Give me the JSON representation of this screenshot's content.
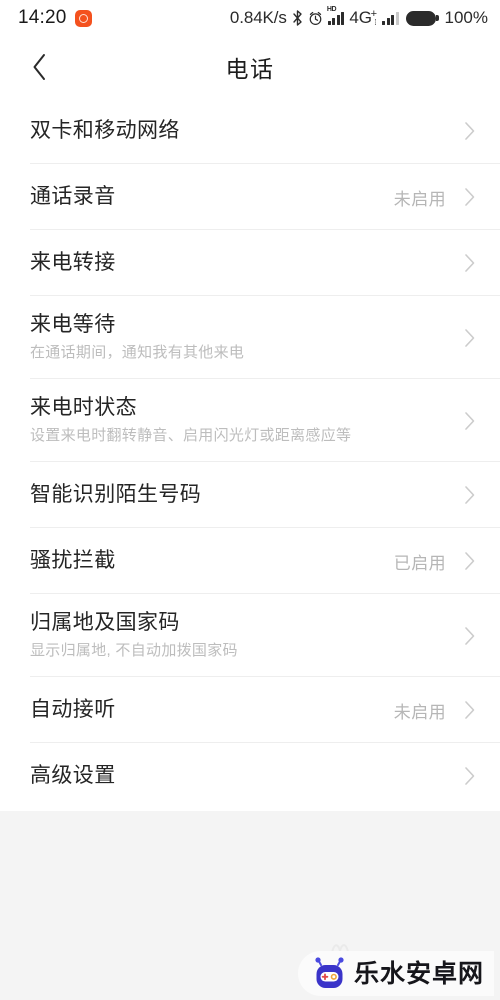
{
  "statusbar": {
    "clock": "14:20",
    "notification_icon": "app-notification-icon",
    "network_speed": "0.84K/s",
    "bluetooth_icon": "bluetooth-icon",
    "alarm_icon": "alarm-clock-icon",
    "hd_label": "HD",
    "signal_icon_1": "signal-bars-icon",
    "network_type": "4G",
    "network_type_sup": "+",
    "network_type_sub": "⁞",
    "signal_icon_2": "signal-bars-icon",
    "battery_icon": "battery-full-icon",
    "battery_percent": "100%"
  },
  "header": {
    "back_icon": "chevron-left-icon",
    "title": "电话"
  },
  "list": {
    "chevron_icon": "chevron-right-icon",
    "items": [
      {
        "title": "双卡和移动网络",
        "subtitle": "",
        "value": ""
      },
      {
        "title": "通话录音",
        "subtitle": "",
        "value": "未启用"
      },
      {
        "title": "来电转接",
        "subtitle": "",
        "value": ""
      },
      {
        "title": "来电等待",
        "subtitle": "在通话期间，通知我有其他来电",
        "value": ""
      },
      {
        "title": "来电时状态",
        "subtitle": "设置来电时翻转静音、启用闪光灯或距离感应等",
        "value": ""
      },
      {
        "title": "智能识别陌生号码",
        "subtitle": "",
        "value": ""
      },
      {
        "title": "骚扰拦截",
        "subtitle": "",
        "value": "已启用"
      },
      {
        "title": "归属地及国家码",
        "subtitle": "显示归属地, 不自动加拨国家码",
        "value": ""
      },
      {
        "title": "自动接听",
        "subtitle": "",
        "value": "未启用"
      },
      {
        "title": "高级设置",
        "subtitle": "",
        "value": ""
      }
    ]
  },
  "watermark": {
    "logo_icon": "robot-mascot-icon",
    "text": "乐水安卓网"
  },
  "colors": {
    "page_bg": "#f4f4f4",
    "card_bg": "#ffffff",
    "title_text": "#252525",
    "subtitle_text": "#bdbdbd",
    "value_text": "#b6b6b6",
    "divider": "#eeeeee",
    "status_icon": "#2b2b2b",
    "notification_accent": "#f4511e",
    "watermark_blue": "#3b3bd6"
  }
}
